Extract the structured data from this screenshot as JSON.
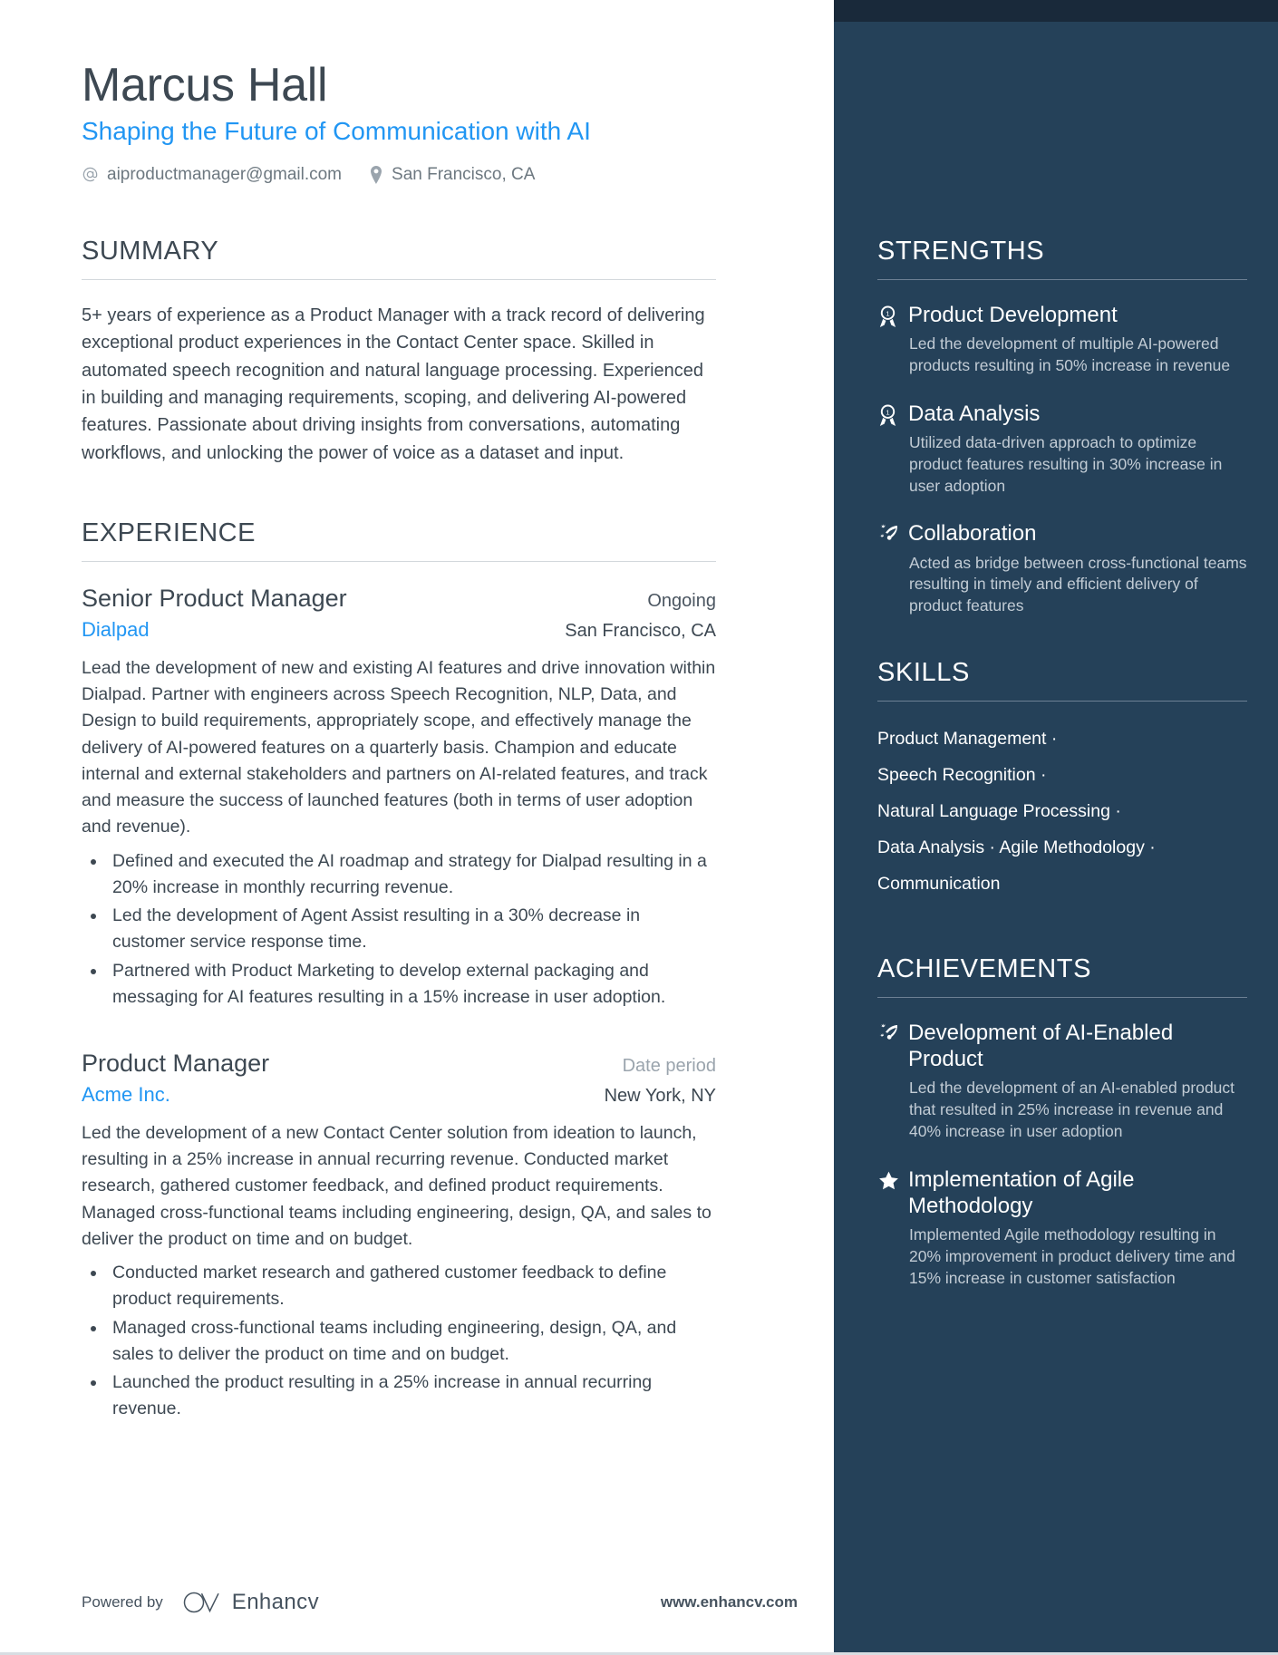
{
  "colors": {
    "accent_blue": "#2196f3",
    "sidebar_bg": "#254159",
    "sidebar_topbar": "#19293a",
    "text_dark": "#3d4852",
    "muted": "#9aa4ad"
  },
  "header": {
    "name": "Marcus Hall",
    "headline": "Shaping the Future of Communication with AI",
    "email": "aiproductmanager@gmail.com",
    "location": "San Francisco, CA",
    "email_icon": "at-sign-icon",
    "location_icon": "map-pin-icon"
  },
  "summary": {
    "title": "SUMMARY",
    "text": "5+ years of experience as a Product Manager with a track record of delivering exceptional product experiences in the Contact Center space. Skilled in automated speech recognition and natural language processing. Experienced in building and managing requirements, scoping, and delivering AI-powered features. Passionate about driving insights from conversations, automating workflows, and unlocking the power of voice as a dataset and input."
  },
  "experience": {
    "title": "EXPERIENCE",
    "jobs": [
      {
        "title": "Senior Product Manager",
        "date": "Ongoing",
        "date_muted": false,
        "company": "Dialpad",
        "location": "San Francisco, CA",
        "description": "Lead the development of new and existing AI features and drive innovation within Dialpad. Partner with engineers across Speech Recognition, NLP, Data, and Design to build requirements, appropriately scope, and effectively manage the delivery of AI-powered features on a quarterly basis. Champion and educate internal and external stakeholders and partners on AI-related features, and track and measure the success of launched features (both in terms of user adoption and revenue).",
        "bullets": [
          "Defined and executed the AI roadmap and strategy for Dialpad resulting in a 20% increase in monthly recurring revenue.",
          "Led the development of Agent Assist resulting in a 30% decrease in customer service response time.",
          "Partnered with Product Marketing to develop external packaging and messaging for AI features resulting in a 15% increase in user adoption."
        ]
      },
      {
        "title": "Product Manager",
        "date": "Date period",
        "date_muted": true,
        "company": "Acme Inc.",
        "location": "New York, NY",
        "description": "Led the development of a new Contact Center solution from ideation to launch, resulting in a 25% increase in annual recurring revenue. Conducted market research, gathered customer feedback, and defined product requirements. Managed cross-functional teams including engineering, design, QA, and sales to deliver the product on time and on budget.",
        "bullets": [
          "Conducted market research and gathered customer feedback to define product requirements.",
          "Managed cross-functional teams including engineering, design, QA, and sales to deliver the product on time and on budget.",
          "Launched the product resulting in a 25% increase in annual recurring revenue."
        ]
      }
    ]
  },
  "strengths": {
    "title": "STRENGTHS",
    "items": [
      {
        "icon": "award-medal-icon",
        "title": "Product Development",
        "description": "Led the development of multiple AI-powered products resulting in 50% increase in revenue"
      },
      {
        "icon": "award-medal-icon",
        "title": "Data Analysis",
        "description": "Utilized data-driven approach to optimize product features resulting in 30% increase in user adoption"
      },
      {
        "icon": "rocket-icon",
        "title": "Collaboration",
        "description": "Acted as bridge between cross-functional teams resulting in timely and efficient delivery of product features"
      }
    ]
  },
  "skills": {
    "title": "SKILLS",
    "separator": "·",
    "lines": [
      "Product Management ·",
      "Speech Recognition ·",
      "Natural Language Processing ·",
      "Data Analysis · Agile Methodology ·",
      "Communication"
    ]
  },
  "achievements": {
    "title": "ACHIEVEMENTS",
    "items": [
      {
        "icon": "rocket-icon",
        "title": "Development of AI-Enabled Product",
        "description": "Led the development of an AI-enabled product that resulted in 25% increase in revenue and 40% increase in user adoption"
      },
      {
        "icon": "star-icon",
        "title": "Implementation of Agile Methodology",
        "description": "Implemented Agile methodology resulting in 20% improvement in product delivery time and 15% increase in customer satisfaction"
      }
    ]
  },
  "footer": {
    "powered_by": "Powered by",
    "brand": "Enhancv",
    "url": "www.enhancv.com",
    "logo_icon": "enhancv-logo-icon"
  }
}
